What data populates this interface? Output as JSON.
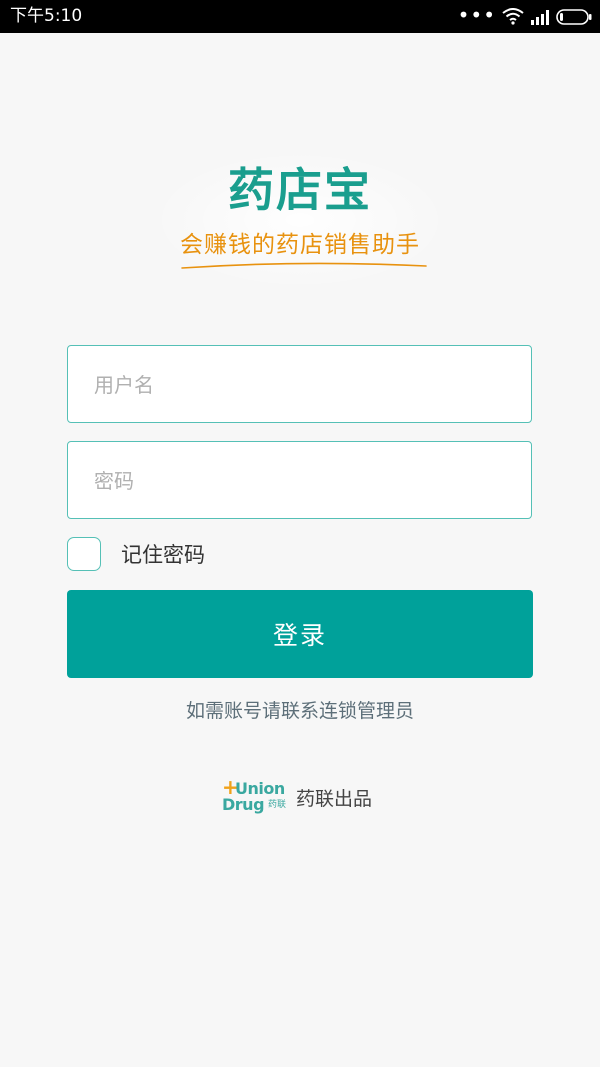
{
  "status_bar": {
    "time": "下午5:10",
    "icons": [
      "more-dots-icon",
      "wifi-icon",
      "signal-icon",
      "battery-icon"
    ]
  },
  "logo": {
    "title": "药店宝",
    "slogan": "会赚钱的药店销售助手"
  },
  "form": {
    "username_placeholder": "用户名",
    "password_placeholder": "密码",
    "remember_label": "记住密码",
    "login_label": "登录"
  },
  "contact_hint": "如需账号请联系连锁管理员",
  "brand": {
    "logo_plus": "+",
    "logo_union": "Union",
    "logo_drug": "Drug",
    "logo_cn": "药联",
    "text": "药联出品"
  },
  "colors": {
    "accent": "#00a19a",
    "title": "#1a9e8e",
    "slogan": "#e8920f",
    "border": "#55c0b6"
  }
}
